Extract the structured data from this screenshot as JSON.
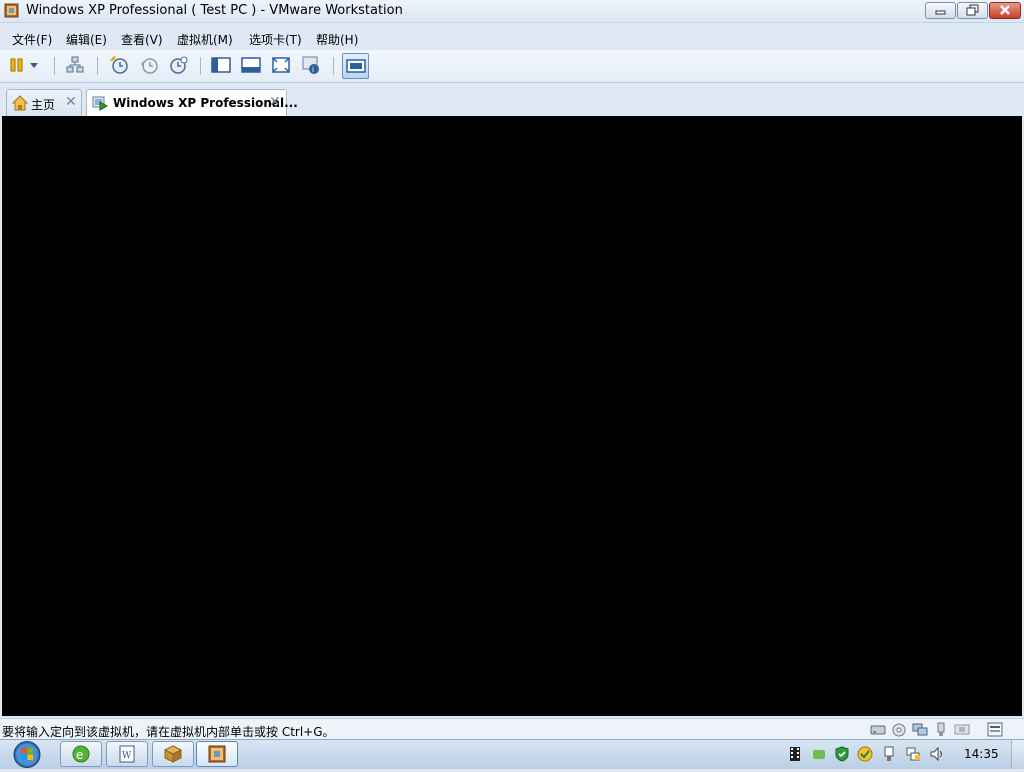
{
  "window": {
    "title": "Windows XP Professional ( Test PC )  - VMware Workstation",
    "icon": "vmware-app-icon",
    "controls": [
      "minimize-icon",
      "maximize-icon",
      "close-icon"
    ]
  },
  "menu": {
    "items": [
      {
        "label": "文件(F)"
      },
      {
        "label": "编辑(E)"
      },
      {
        "label": "查看(V)"
      },
      {
        "label": "虚拟机(M)"
      },
      {
        "label": "选项卡(T)"
      },
      {
        "label": "帮助(H)"
      }
    ]
  },
  "toolbar": {
    "icons": [
      "pause-icon",
      "dropdown-arrow-icon",
      "network-icon",
      "snapshot-icon",
      "revert-snapshot-icon",
      "snapshot-manager-icon",
      "console-view-icon",
      "quick-switch-icon",
      "full-screen-icon",
      "unity-icon",
      "thumbnail-bar-icon"
    ]
  },
  "tabs": {
    "home": {
      "label": "主页"
    },
    "vm": {
      "label": "Windows XP Professional..."
    }
  },
  "status": {
    "message": "要将输入定向到该虚拟机，请在虚拟机内部单击或按 Ctrl+G。"
  },
  "taskbar": {
    "clock": "14:35"
  },
  "colors": {
    "vm_screen": "#000000",
    "accent": "#3f7fcf",
    "close_button": "#c7402a"
  }
}
